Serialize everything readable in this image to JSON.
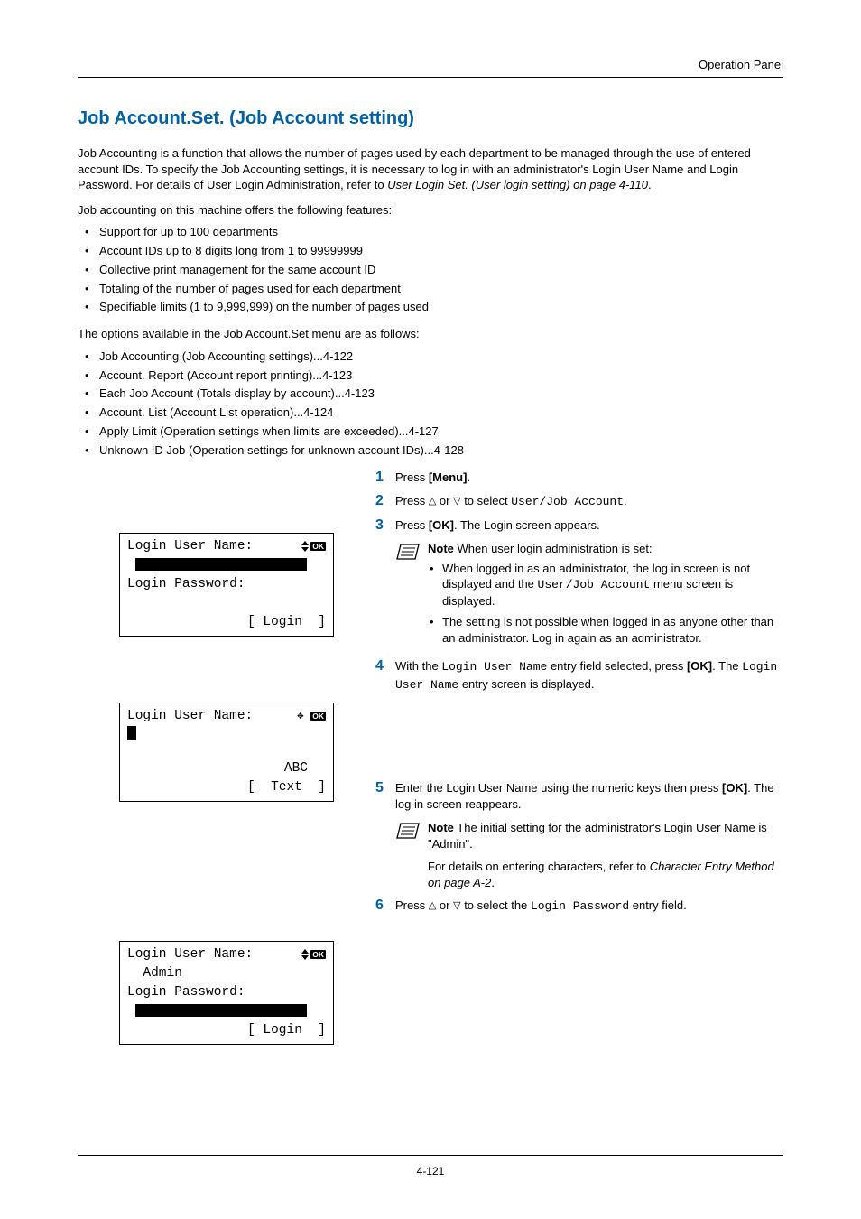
{
  "header": {
    "section": "Operation Panel"
  },
  "title": "Job Account.Set. (Job Account setting)",
  "intro": "Job Accounting is a function that allows the number of pages used by each department to be managed through the use of entered account IDs. To specify the Job Accounting settings, it is necessary to log in with an administrator's Login User Name and Login Password. For details of User Login Administration, refer to ",
  "intro_link": "User Login Set. (User login setting) on page 4-110",
  "intro_end": ".",
  "features_intro": "Job accounting on this machine offers the following features:",
  "features": [
    "Support for up to 100 departments",
    "Account IDs up to 8 digits long from 1 to 99999999",
    "Collective print management for the same account ID",
    "Totaling of the number of pages used for each department",
    "Specifiable limits (1 to 9,999,999) on the number of pages used"
  ],
  "options_intro": "The options available in the Job Account.Set menu are as follows:",
  "options": [
    "Job Accounting (Job Accounting settings)...4-122",
    "Account. Report (Account report printing)...4-123",
    "Each Job Account (Totals display by account)...4-123",
    "Account. List (Account List operation)...4-124",
    "Apply Limit (Operation settings when limits are exceeded)...4-127",
    "Unknown ID Job (Operation settings for unknown account IDs)...4-128"
  ],
  "steps": {
    "s1": {
      "pre": "Press ",
      "bold": "[Menu]",
      "post": "."
    },
    "s2": {
      "pre": "Press ",
      "mid": " or ",
      "post": " to select ",
      "mono": "User/Job Account",
      "end": "."
    },
    "s3": {
      "pre": "Press ",
      "bold": "[OK]",
      "post": ". The Login screen appears."
    },
    "note3_label": "Note",
    "note3_intro": "  When user login administration is set:",
    "note3_li1a": "When logged in as an administrator, the log in screen is not displayed and the ",
    "note3_li1_mono": "User/Job Account",
    "note3_li1b": " menu screen is displayed.",
    "note3_li2": "The setting is not possible when logged in as anyone other than an administrator. Log in again as an administrator.",
    "s4a": "With the ",
    "s4_mono1": "Login User Name",
    "s4b": " entry field selected, press ",
    "s4_bold": "[OK]",
    "s4c": ". The ",
    "s4_mono2": "Login User Name",
    "s4d": " entry screen is displayed.",
    "s5a": "Enter the Login User Name using the numeric keys then press ",
    "s5_bold": "[OK]",
    "s5b": ". The log in screen reappears.",
    "note5_label": "Note",
    "note5_text": "  The initial setting for the administrator's Login User Name is \"Admin\".",
    "note5_extra_a": "For details on entering characters, refer to ",
    "note5_extra_link": "Character Entry Method on page A-2",
    "note5_extra_b": ".",
    "s6a": "Press ",
    "s6b": " or ",
    "s6c": " to select the ",
    "s6_mono": "Login Password",
    "s6d": " entry field."
  },
  "lcd1": {
    "line1": "Login User Name:",
    "line2_label": "Login Password:",
    "softkey": "[ Login  ]"
  },
  "lcd2": {
    "line1": "Login User Name:",
    "mode": "ABC",
    "softkey": "[  Text  ]"
  },
  "lcd3": {
    "line1": "Login User Name:",
    "value": "  Admin",
    "line2_label": "Login Password:",
    "softkey": "[ Login  ]"
  },
  "icons": {
    "ok_label": "OK"
  },
  "footer": {
    "page": "4-121"
  }
}
